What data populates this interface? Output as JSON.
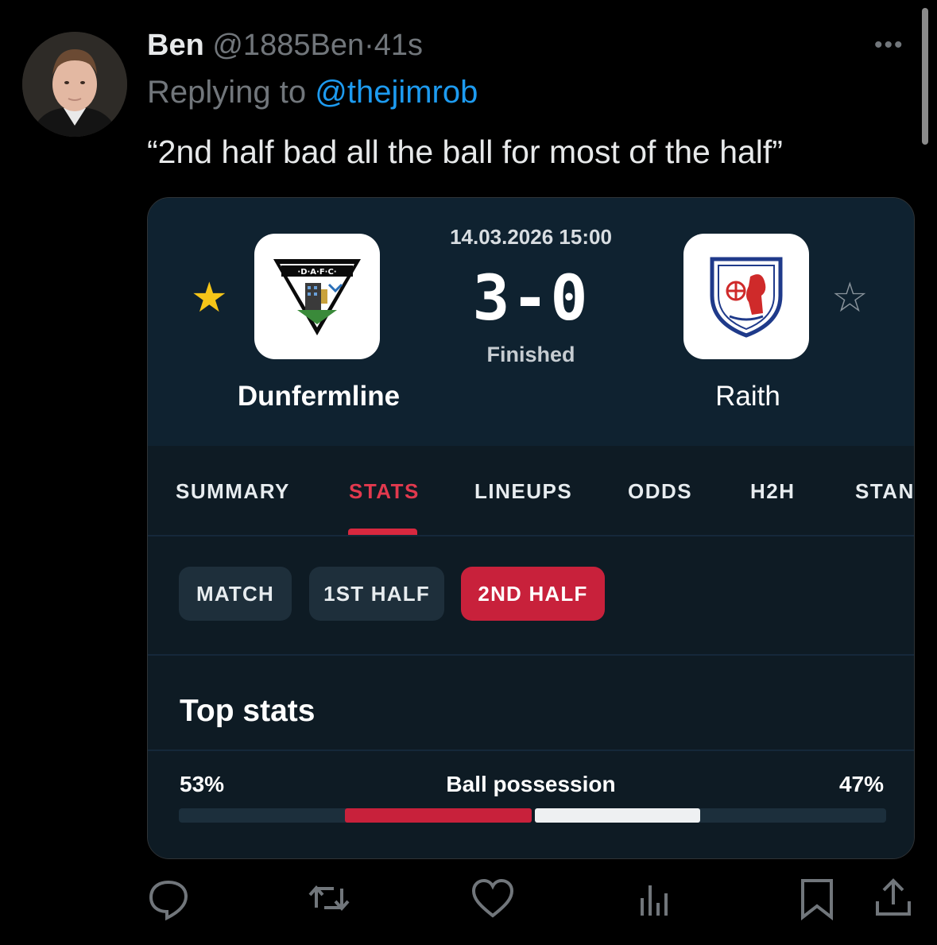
{
  "tweet": {
    "author_name": "Ben",
    "author_handle": "@1885Ben",
    "separator": "·",
    "time": "41s",
    "replying_prefix": "Replying to",
    "replying_to": "@thejimrob",
    "text": "“2nd half bad all the ball for most of the half”",
    "more_icon": "more-horizontal-icon"
  },
  "match": {
    "datetime": "14.03.2026 15:00",
    "score": "3-0",
    "status": "Finished",
    "home": {
      "name": "Dunfermline",
      "logo_text": "·D·A·F·C·",
      "favorite": true
    },
    "away": {
      "name": "Raith",
      "favorite": false
    }
  },
  "tabs": [
    "SUMMARY",
    "STATS",
    "LINEUPS",
    "ODDS",
    "H2H",
    "STAN"
  ],
  "active_tab": "STATS",
  "periods": [
    "MATCH",
    "1ST HALF",
    "2ND HALF"
  ],
  "active_period": "2ND HALF",
  "section_title": "Top stats",
  "stats": [
    {
      "label": "Ball possession",
      "home": "53%",
      "away": "47%",
      "home_value": 53,
      "away_value": 47
    }
  ],
  "colors": {
    "accent_red": "#c8213b",
    "link_blue": "#1d9bf0",
    "star_gold": "#f5c518",
    "card_bg": "#0e1b24"
  },
  "actions": [
    "reply-icon",
    "retweet-icon",
    "like-icon",
    "views-icon",
    "bookmark-icon",
    "share-icon"
  ]
}
